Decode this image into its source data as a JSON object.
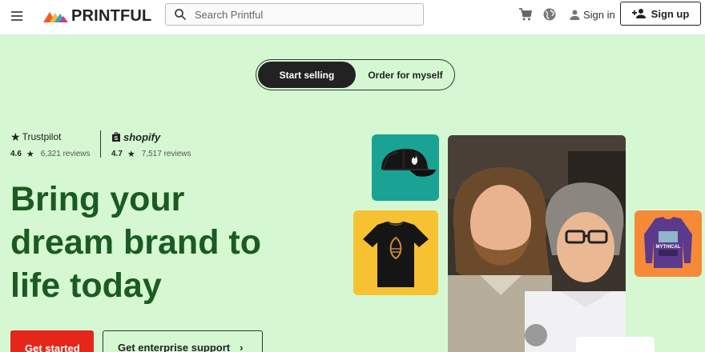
{
  "header": {
    "logo_text": "PRINTFUL",
    "search_placeholder": "Search Printful",
    "signin_label": "Sign in",
    "signup_label": "Sign up"
  },
  "toggle": {
    "active_label": "Start selling",
    "inactive_label": "Order for myself"
  },
  "ratings": [
    {
      "brand": "Trustpilot",
      "score": "4.6",
      "reviews": "6,321 reviews"
    },
    {
      "brand": "shopify",
      "score": "4.7",
      "reviews": "7,517 reviews"
    }
  ],
  "hero": {
    "headline_line1": "Bring your",
    "headline_line2": "dream brand to",
    "headline_line3": "life today",
    "primary_cta": "Get started",
    "secondary_cta": "Get enterprise support"
  },
  "products": {
    "sweatshirt_print": "MYTHICAL"
  },
  "icons": [
    "menu-icon",
    "printful-logo-icon",
    "search-icon",
    "cart-icon",
    "globe-icon",
    "user-icon",
    "add-user-icon",
    "star-icon",
    "shopify-bag-icon",
    "chevron-right-icon"
  ],
  "colors": {
    "background": "#d5f8d3",
    "headline": "#1a5b22",
    "primary_button": "#e4271a",
    "cap_tile": "#1aa394",
    "shirt_tile": "#f7c232",
    "sweatshirt_tile": "#f78a38"
  }
}
